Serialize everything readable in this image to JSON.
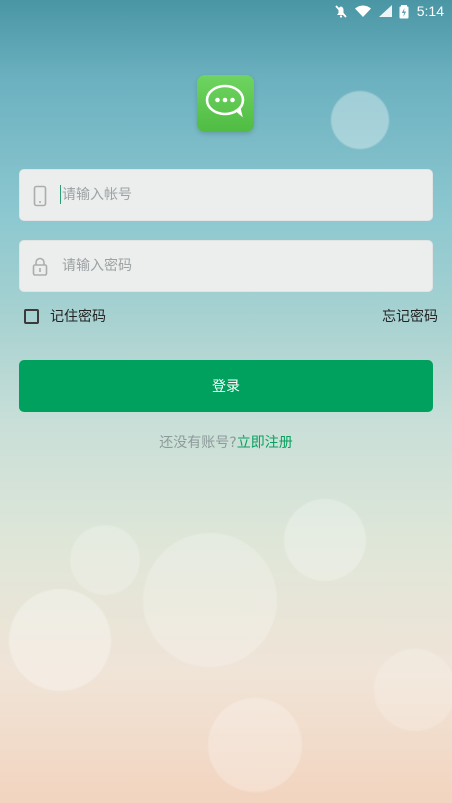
{
  "status_bar": {
    "time": "5:14",
    "icons": [
      "ringer-off-icon",
      "wifi-icon",
      "signal-icon",
      "battery-charging-icon"
    ]
  },
  "app_logo": {
    "icon": "chat-bubble-icon",
    "color": "#5bc64f"
  },
  "login_form": {
    "account_placeholder": "请输入帐号",
    "password_placeholder": "请输入密码",
    "account_icon": "phone-icon",
    "password_icon": "lock-icon",
    "remember_label": "记住密码",
    "remember_checked": false,
    "forgot_label": "忘记密码",
    "login_label": "登录"
  },
  "register": {
    "question": "还没有账号?",
    "link": "立即注册"
  },
  "colors": {
    "accent": "#00a05e",
    "link": "#08a05f",
    "input_background": "#eceeed"
  }
}
